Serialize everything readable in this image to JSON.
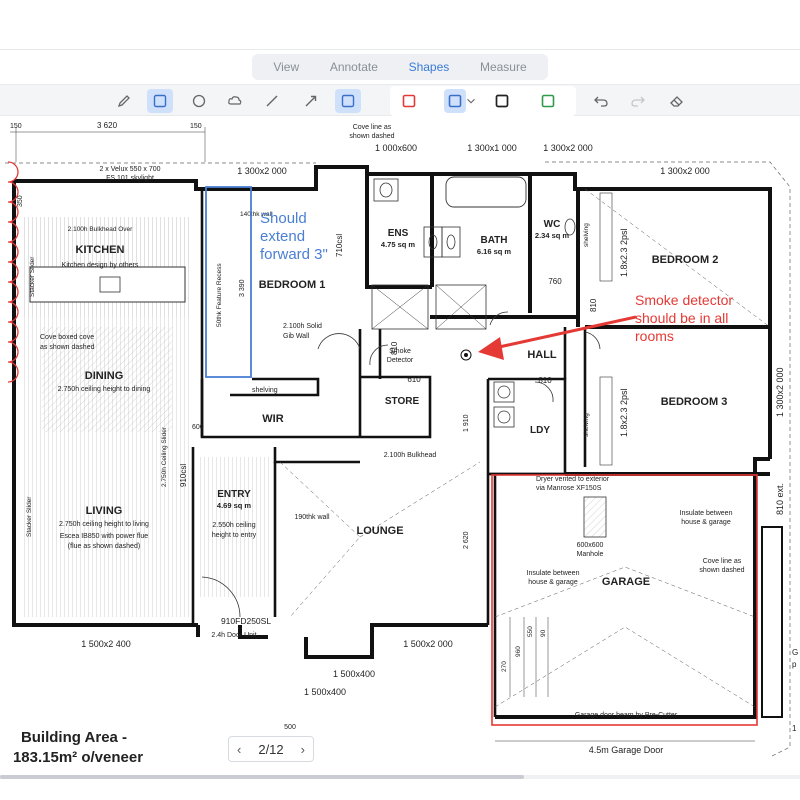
{
  "tabs": [
    {
      "label": "View"
    },
    {
      "label": "Annotate"
    },
    {
      "label": "Shapes"
    },
    {
      "label": "Measure"
    }
  ],
  "active_tab": "Shapes",
  "toolbar": {
    "tools": [
      "pen-icon",
      "rectangle-icon",
      "circle-icon",
      "cloud-icon",
      "line-icon",
      "arrow-icon",
      "filled-rectangle-icon"
    ],
    "colors": {
      "red": "#e53935",
      "blue": "#4a7fd4",
      "black": "#222222",
      "green": "#2e9b4a"
    },
    "actions": [
      "undo-icon",
      "redo-icon",
      "eraser-icon"
    ]
  },
  "plan": {
    "rooms": {
      "kitchen": "KITCHEN",
      "kitchen_note": "Kitchen design by others",
      "kitchen_bulkhead": "2.100h Bulkhead Over",
      "dining": "DINING",
      "dining_note": "2.750h ceiling height to dining",
      "living": "LIVING",
      "living_note": "2.750h ceiling height to living",
      "living_note2": "Escea IB850 with power flue",
      "living_note3": "(flue as shown dashed)",
      "bedroom1": "BEDROOM 1",
      "ens": "ENS",
      "ens_area": "4.75 sq m",
      "bath": "BATH",
      "bath_area": "6.16 sq m",
      "wc": "WC",
      "wc_area": "2.34 sq m",
      "bedroom2": "BEDROOM 2",
      "bedroom3": "BEDROOM 3",
      "hall": "HALL",
      "wir": "WIR",
      "store": "STORE",
      "ldy": "LDY",
      "entry": "ENTRY",
      "entry_area": "4.69 sq m",
      "entry_note": "2.550h ceiling",
      "entry_note2": "height to entry",
      "lounge": "LOUNGE",
      "garage": "GARAGE"
    },
    "labels": {
      "window_top_left": "2 x Velux 550 x 700",
      "skylight": "FS 101 skylight",
      "cove_top": "Cove line as",
      "cove_top2": "shown dashed",
      "window_1000x600": "1 000x600",
      "window_1300x1000": "1 300x1 000",
      "window_1300x2000_a": "1 300x2 000",
      "window_1300x2000_b": "1 300x2 000",
      "window_1300x2000_right": "1 300x2 000",
      "dim_3620": "3 620",
      "dim_150a": "150",
      "dim_150b": "150",
      "dim_3390": "3 390",
      "dim_710": "710csl",
      "dim_760": "760",
      "dim_810a": "810",
      "dim_810b": "810",
      "dim_810c": "810",
      "dim_610": "610",
      "dim_1910": "1 910",
      "dim_2620": "2 620",
      "dim_910": "910csl",
      "window_1800_b2": "1.8x2.3 2psl",
      "window_1800_b3": "1.8x2.3 2psl",
      "shelving_wir": "shelving",
      "shelving_b2": "shelving",
      "shelving_b3": "shelving",
      "solid_wall": "2.100h Solid",
      "solid_wall2": "Gib Wall",
      "smoke_detector": "Smoke",
      "smoke_detector2": "Detector",
      "bulkhead_hall": "2.100h Bulkhead",
      "wall_190": "190thk wall",
      "wall_140": "140thk wall",
      "feature_recess": "50thk Feature Recess",
      "dryer": "Dryer vented to exterior",
      "dryer2": "via Manrose XF150S",
      "manhole": "600x600",
      "manhole2": "Manhole",
      "insulate_a": "Insulate between",
      "insulate_a2": "house & garage",
      "insulate_b": "Insulate between",
      "insulate_b2": "house & garage",
      "cove_garage": "Cove line as",
      "cove_garage2": "shown dashed",
      "garage_beam": "Garage door beam by Pre-Cutter",
      "garage_door": "4.5m Garage Door",
      "ext_810": "810 ext.",
      "entry_door": "910FD250SL",
      "entry_door2": "2.4h Door Unit",
      "window_1500x2400": "1 500x2 400",
      "window_1500x2000": "1 500x2 000",
      "window_1500x400_a": "1 500x400",
      "window_1500x400_b": "1 500x400",
      "dim_500": "500",
      "dim_2750": "2.750h Ceiling Slider",
      "sliding_stacker": "Stacker Slider",
      "sliding_stacker2": "Stacker Slider",
      "dim_600": "600",
      "dim_350": "350",
      "dim_270": "270",
      "dim_960": "960",
      "dim_550": "550",
      "dim_90": "90",
      "side_g": "G",
      "side_g2": "p",
      "side_1": "1",
      "cove_box": "Cove boxed cove",
      "cove_box2": "as shown dashed"
    },
    "building_area": "Building Area -",
    "building_area2": "183.15m² o/veneer"
  },
  "annotations": {
    "blue_note_1": "Should",
    "blue_note_2": "extend",
    "blue_note_3": "forward 3\"",
    "red_note_1": "Smoke detector",
    "red_note_2": "should be in all",
    "red_note_3": "rooms",
    "blue_color": "#4a7fd4",
    "red_color": "#e53935"
  },
  "pager": {
    "current": "2",
    "total": "12",
    "display": "2/12"
  }
}
